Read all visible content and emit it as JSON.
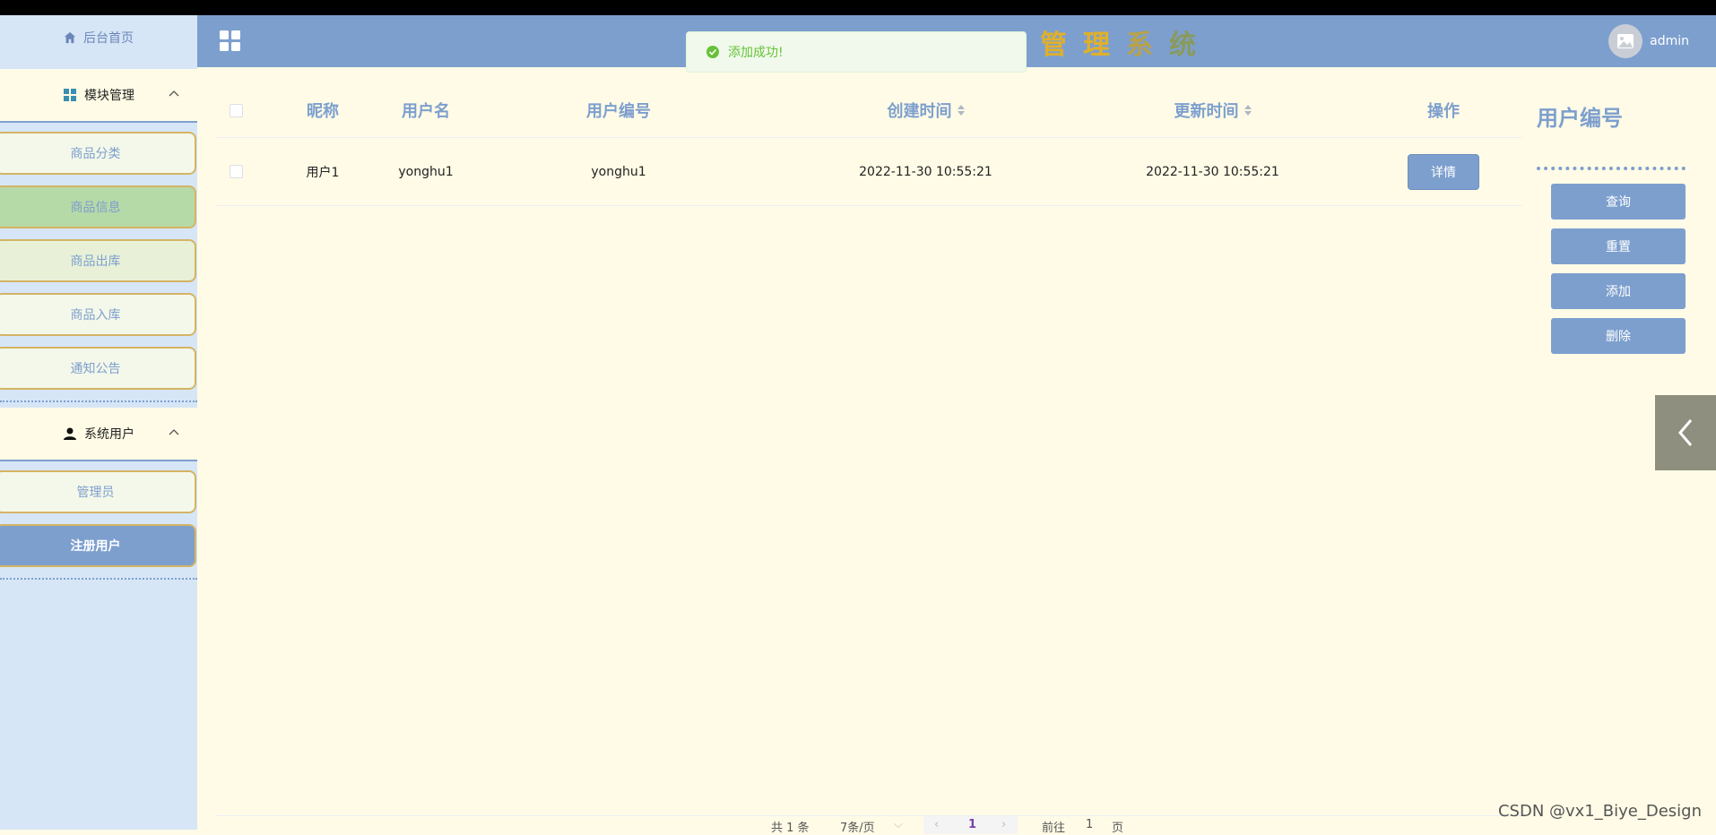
{
  "sidebar": {
    "home": "后台首页",
    "group1": {
      "label": "模块管理",
      "items": [
        "商品分类",
        "商品信息",
        "商品出库",
        "商品入库",
        "通知公告"
      ]
    },
    "group2": {
      "label": "系统用户",
      "items": [
        "管理员",
        "注册用户"
      ]
    }
  },
  "header": {
    "title_chars": [
      "管",
      "理",
      "系",
      "统"
    ],
    "title_colors": [
      "#e0b02a",
      "#e0b02a",
      "#b8a24a",
      "#8a9a5a"
    ],
    "user": "admin"
  },
  "toast": {
    "text": "添加成功!"
  },
  "table": {
    "headers": {
      "nickname": "昵称",
      "username": "用户名",
      "usercode": "用户编号",
      "created": "创建时间",
      "updated": "更新时间",
      "actions": "操作"
    },
    "rows": [
      {
        "nickname": "用户1",
        "username": "yonghu1",
        "usercode": "yonghu1",
        "created": "2022-11-30 10:55:21",
        "updated": "2022-11-30 10:55:21",
        "action_label": "详情"
      }
    ]
  },
  "right_panel": {
    "title": "用户编号",
    "buttons": [
      "查询",
      "重置",
      "添加",
      "删除"
    ]
  },
  "pagination": {
    "total": "共 1 条",
    "page_size": "7条/页",
    "current": "1",
    "goto_label": "前往",
    "goto_value": "1",
    "page_unit": "页"
  },
  "watermark": "CSDN @vx1_Biye_Design",
  "colors": {
    "accent": "#7d9fce",
    "background": "#fffbe6",
    "sidebar": "#d6e6f7",
    "border_gold": "#d5b464",
    "success": "#67c23a"
  }
}
